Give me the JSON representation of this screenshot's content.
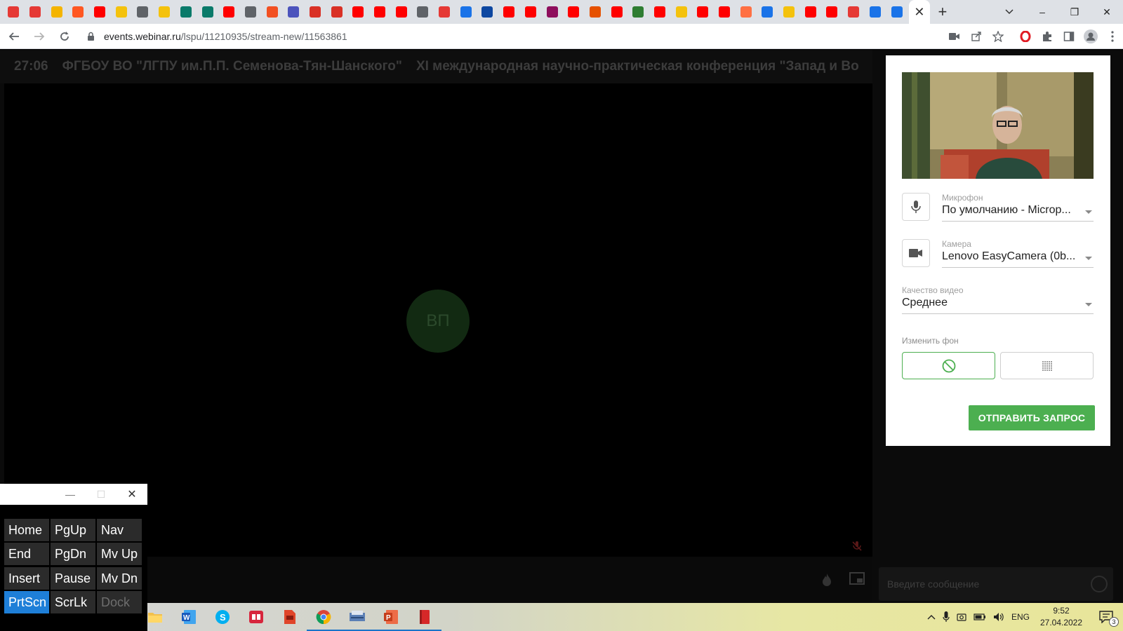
{
  "browser": {
    "active_tab_close": "✕",
    "new_tab": "+",
    "url_host": "events.webinar.ru",
    "url_path": "/lspu/11210935/stream-new/11563861",
    "window_controls": [
      "–",
      "❐",
      "✕"
    ],
    "tab_favicons": [
      "#e53935",
      "#e53935",
      "#f4b400",
      "#ff5722",
      "#ff0000",
      "#f4c20d",
      "#5f6368",
      "#f4c20d",
      "#0a7a6a",
      "#0a7a6a",
      "#ff0000",
      "#5f6368",
      "#f25022",
      "#4b53bc",
      "#d93025",
      "#d93025",
      "#ff0000",
      "#ff0000",
      "#ff0000",
      "#5f6368",
      "#e53935",
      "#1a73e8",
      "#0d47a1",
      "#ff0000",
      "#ff0000",
      "#8e0e5d",
      "#ff0000",
      "#e65100",
      "#ff0000",
      "#2e7d32",
      "#ff0000",
      "#f4c20d",
      "#ff0000",
      "#ff0000",
      "#ff7043",
      "#1a73e8",
      "#f4c20d",
      "#ff0000",
      "#ff0000",
      "#e53935",
      "#1a73e8",
      "#1a73e8"
    ]
  },
  "webinar": {
    "timer": "27:06",
    "organizer": "ФГБОУ ВО \"ЛГПУ им.П.П. Семенова-Тян-Шанского\"",
    "event_title": "XI международная научно-практическая конференция \"Запад и Во",
    "avatar_initials": "ВП",
    "chat_placeholder": "Введите сообщение"
  },
  "settings_panel": {
    "microphone_label": "Микрофон",
    "microphone_value": "По умолчанию - Microp...",
    "camera_label": "Камера",
    "camera_value": "Lenovo EasyCamera (0b...",
    "quality_label": "Качество видео",
    "quality_value": "Среднее",
    "background_label": "Изменить фон",
    "submit_label": "ОТПРАВИТЬ ЗАПРОС",
    "accent_color": "#4caf50"
  },
  "osk": {
    "keys": [
      [
        "Home",
        "PgUp",
        "Nav"
      ],
      [
        "End",
        "PgDn",
        "Mv Up"
      ],
      [
        "Insert",
        "Pause",
        "Mv Dn"
      ],
      [
        "PrtScn",
        "ScrLk",
        "Dock"
      ]
    ],
    "highlighted": "PrtScn",
    "disabled": "Dock"
  },
  "taskbar": {
    "language": "ENG",
    "time": "9:52",
    "date": "27.04.2022",
    "notifications": "3"
  }
}
